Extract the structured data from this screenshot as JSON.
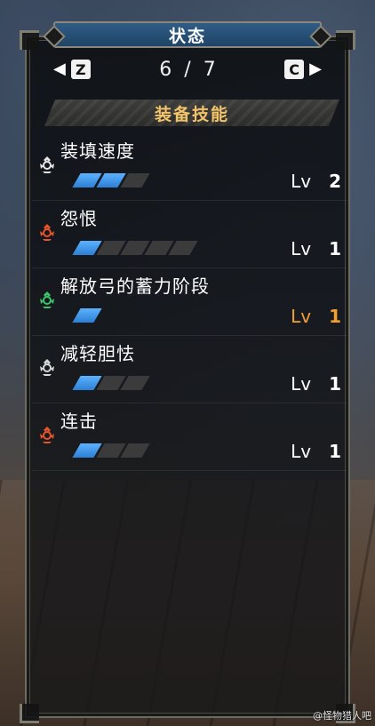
{
  "header": {
    "title": "状态",
    "prev_key": "Z",
    "next_key": "C",
    "page_current": "6",
    "page_separator": "/",
    "page_total": "7"
  },
  "section": {
    "title": "装备技能"
  },
  "skills": [
    {
      "name": "装填速度",
      "level_label": "Lv",
      "level": "2",
      "filled": 2,
      "slots": 3,
      "icon_color": "#e6e6e6",
      "highlight": false
    },
    {
      "name": "怨恨",
      "level_label": "Lv",
      "level": "1",
      "filled": 1,
      "slots": 5,
      "icon_color": "#e8542c",
      "highlight": false
    },
    {
      "name": "解放弓的蓄力阶段",
      "level_label": "Lv",
      "level": "1",
      "filled": 1,
      "slots": 1,
      "icon_color": "#3cc46a",
      "highlight": true
    },
    {
      "name": "减轻胆怯",
      "level_label": "Lv",
      "level": "1",
      "filled": 1,
      "slots": 3,
      "icon_color": "#d8d8d8",
      "highlight": false
    },
    {
      "name": "连击",
      "level_label": "Lv",
      "level": "1",
      "filled": 1,
      "slots": 3,
      "icon_color": "#e8542c",
      "highlight": false
    }
  ],
  "watermark": "@怪物猎人吧",
  "colors": {
    "accent_blue": "#2c7fd4",
    "section_gold": "#f1c36a",
    "level_highlight": "#f0a030"
  }
}
